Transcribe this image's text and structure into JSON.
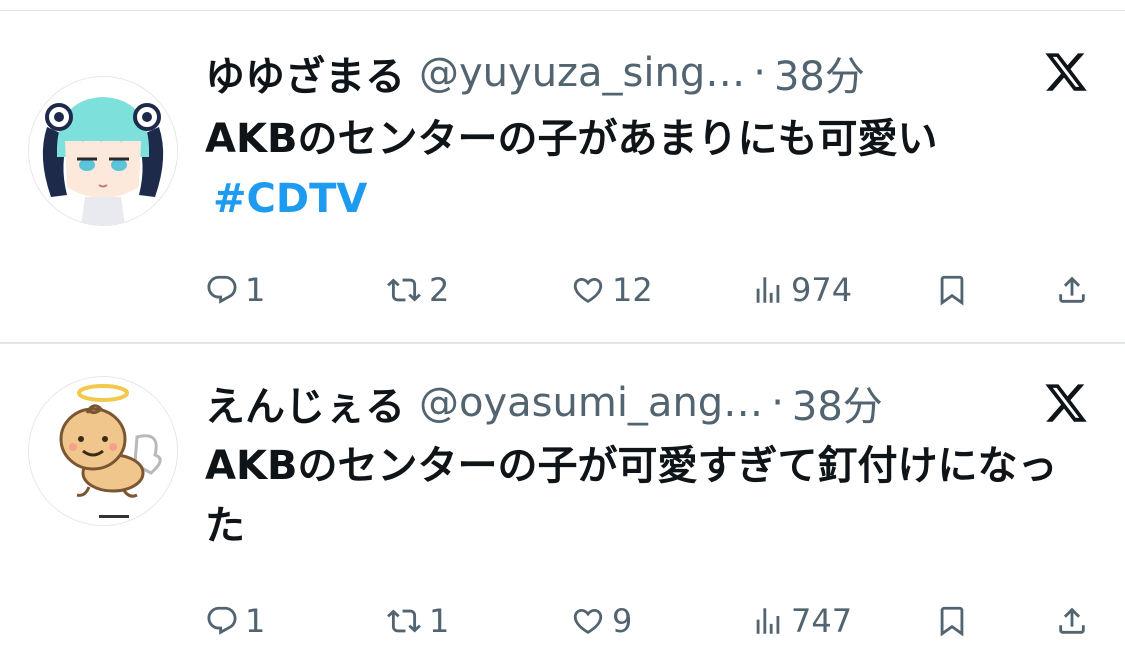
{
  "tweets": [
    {
      "display_name": "ゆゆざまる",
      "handle": "@yuyuza_sing…",
      "separator": "·",
      "time": "38分",
      "text": "AKBのセンターの子があまりにも可愛い",
      "hashtag": "#CDTV",
      "reply_count": "1",
      "retweet_count": "2",
      "like_count": "12",
      "view_count": "974",
      "avatar_icon": "anime-girl-avatar"
    },
    {
      "display_name": "えんじぇる",
      "handle": "@oyasumi_ang…",
      "separator": "·",
      "time": "38分",
      "text": "AKBのセンターの子が可愛すぎて釘付けになった",
      "reply_count": "1",
      "retweet_count": "1",
      "like_count": "9",
      "view_count": "747",
      "avatar_icon": "angel-baby-avatar"
    }
  ],
  "icons": {
    "brand": "x-logo-icon",
    "reply": "reply-icon",
    "retweet": "retweet-icon",
    "like": "heart-icon",
    "views": "views-icon",
    "bookmark": "bookmark-icon",
    "share": "share-icon"
  },
  "colors": {
    "hashtag": "#1d9bf0",
    "secondary_text": "#536471",
    "primary_text": "#0f1419",
    "divider": "#e1e4e8"
  }
}
